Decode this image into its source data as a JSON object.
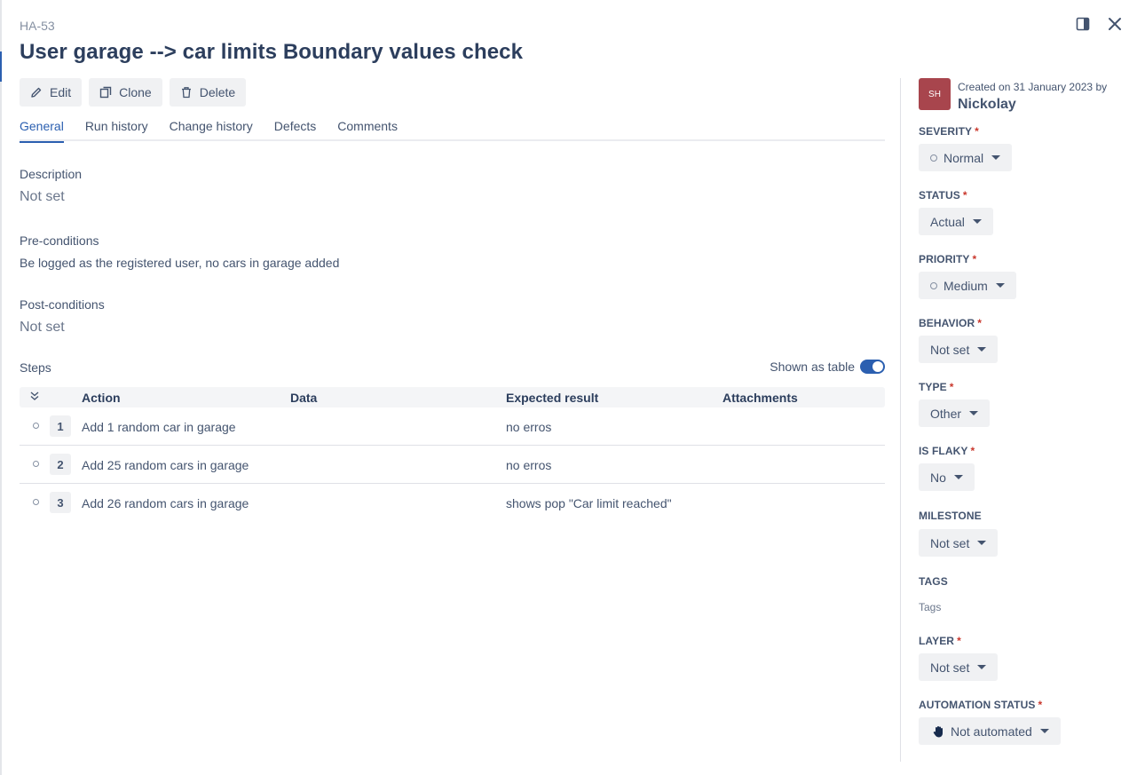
{
  "header": {
    "case_key": "HA-53",
    "title": "User garage --> car limits Boundary values check"
  },
  "toolbar": {
    "edit_label": "Edit",
    "clone_label": "Clone",
    "delete_label": "Delete"
  },
  "tabs": [
    {
      "label": "General",
      "active": true
    },
    {
      "label": "Run history",
      "active": false
    },
    {
      "label": "Change history",
      "active": false
    },
    {
      "label": "Defects",
      "active": false
    },
    {
      "label": "Comments",
      "active": false
    }
  ],
  "general": {
    "description_label": "Description",
    "description_value": "Not set",
    "preconditions_label": "Pre-conditions",
    "preconditions_value": "Be logged as the registered user, no cars in garage added",
    "postconditions_label": "Post-conditions",
    "postconditions_value": "Not set"
  },
  "steps": {
    "label": "Steps",
    "toggle_label": "Shown as table",
    "toggle_on": true,
    "columns": {
      "action": "Action",
      "data": "Data",
      "expected": "Expected result",
      "attachments": "Attachments"
    },
    "rows": [
      {
        "num": "1",
        "action": "Add 1 random car in garage",
        "data": "",
        "expected": "no erros"
      },
      {
        "num": "2",
        "action": "Add 25 random cars in garage",
        "data": "",
        "expected": "no erros"
      },
      {
        "num": "3",
        "action": "Add 26 random cars in garage",
        "data": "",
        "expected": "shows pop \"Car limit reached\""
      }
    ]
  },
  "sidebar": {
    "avatar_initials": "SH",
    "created_text": "Created on 31 January 2023 by",
    "creator": "Nickolay",
    "severity_label": "SEVERITY",
    "severity_value": "Normal",
    "status_label": "STATUS",
    "status_value": "Actual",
    "priority_label": "PRIORITY",
    "priority_value": "Medium",
    "behavior_label": "BEHAVIOR",
    "behavior_value": "Not set",
    "type_label": "TYPE",
    "type_value": "Other",
    "is_flaky_label": "IS FLAKY",
    "is_flaky_value": "No",
    "milestone_label": "MILESTONE",
    "milestone_value": "Not set",
    "tags_label": "TAGS",
    "tags_placeholder": "Tags",
    "layer_label": "LAYER",
    "layer_value": "Not set",
    "automation_status_label": "AUTOMATION STATUS",
    "automation_status_value": "Not automated"
  },
  "colors": {
    "accent": "#2b5fb0",
    "avatar_bg": "#a8454d",
    "required_star": "#c9372c"
  },
  "icons": [
    "pencil-icon",
    "clone-icon",
    "trash-icon",
    "panel-icon",
    "close-icon",
    "collapse-all-icon",
    "hand-icon",
    "chevron-down-icon"
  ]
}
